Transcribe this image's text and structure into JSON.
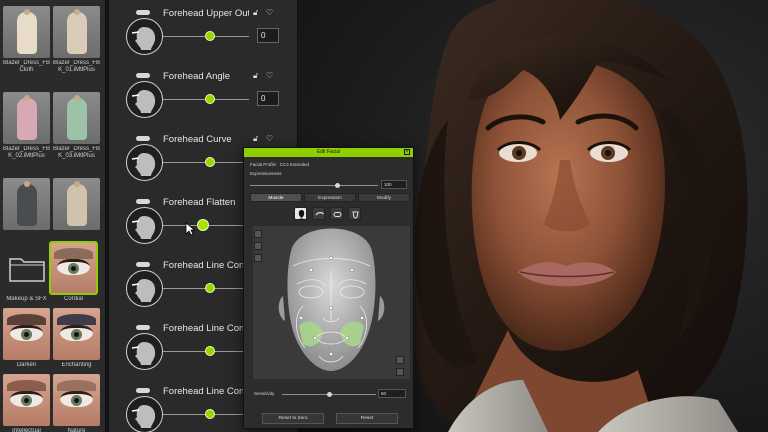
{
  "library": {
    "items": [
      {
        "label": "Blazer_Dress_FB.cc\nCloth",
        "kind": "dress",
        "color": "#e8dcc8",
        "selected": false
      },
      {
        "label": "Blazer_Dress_FB\nK_01.iMtlPlus",
        "kind": "dress",
        "color": "#d8ccb8",
        "selected": false
      },
      {
        "label": "Blazer_Dress_FB_2\nK_02.iMtlPlus",
        "kind": "dress",
        "color": "#d7a9b4",
        "selected": false
      },
      {
        "label": "Blazer_Dress_FB\nK_03.iMtlPlus",
        "kind": "dress",
        "color": "#9cc3a8",
        "selected": false
      },
      {
        "label": "",
        "kind": "dress",
        "color": "#4a4d50",
        "selected": false
      },
      {
        "label": "",
        "kind": "dress",
        "color": "#cfc3ae",
        "selected": false
      },
      {
        "label": "Makeup & SFX",
        "kind": "folder",
        "selected": false
      },
      {
        "label": "Cordial",
        "kind": "eye",
        "lid": "#8c6a5c",
        "selected": true
      },
      {
        "label": "Darken",
        "kind": "eye",
        "lid": "#5b4038",
        "selected": false
      },
      {
        "label": "Enchanting",
        "kind": "eye",
        "lid": "#3f3b46",
        "selected": false
      },
      {
        "label": "Intellectual",
        "kind": "eye",
        "lid": "#8a5d4d",
        "selected": false
      },
      {
        "label": "Nature",
        "kind": "eye",
        "lid": "#9a7061",
        "selected": false
      }
    ]
  },
  "morphs": [
    {
      "label": "Forehead Upper Oute",
      "value": "0",
      "fraction": 0.55,
      "active": false
    },
    {
      "label": "Forehead Angle",
      "value": "0",
      "fraction": 0.55,
      "active": false
    },
    {
      "label": "Forehead Curve",
      "value": "",
      "fraction": 0.55,
      "active": false
    },
    {
      "label": "Forehead Flatten",
      "value": "",
      "fraction": 0.47,
      "active": true
    },
    {
      "label": "Forehead Line Conto",
      "value": "",
      "fraction": 0.55,
      "active": false
    },
    {
      "label": "Forehead Line Conto",
      "value": "",
      "fraction": 0.55,
      "active": false
    },
    {
      "label": "Forehead Line Conto",
      "value": "",
      "fraction": 0.55,
      "active": false
    }
  ],
  "edit_facial": {
    "title": "Edit Facial",
    "profile_label": "Facial Profile : CC4 Extended",
    "expressiveness_label": "Expressiveness",
    "expressiveness_value": "100",
    "expressiveness_fraction": 0.68,
    "tabs": [
      {
        "label": "Muscle",
        "active": true
      },
      {
        "label": "Expression",
        "active": false
      },
      {
        "label": "Modify",
        "active": false
      }
    ],
    "sensitivity_label": "Sensitivity",
    "sensitivity_value": "50",
    "sensitivity_fraction": 0.5,
    "reset_zero_label": "Reset to Zero",
    "reset_label": "Reset",
    "highlight_color": "#a8d88a"
  },
  "colors": {
    "accent": "#8fcf00",
    "panel": "#2a2a2a"
  }
}
